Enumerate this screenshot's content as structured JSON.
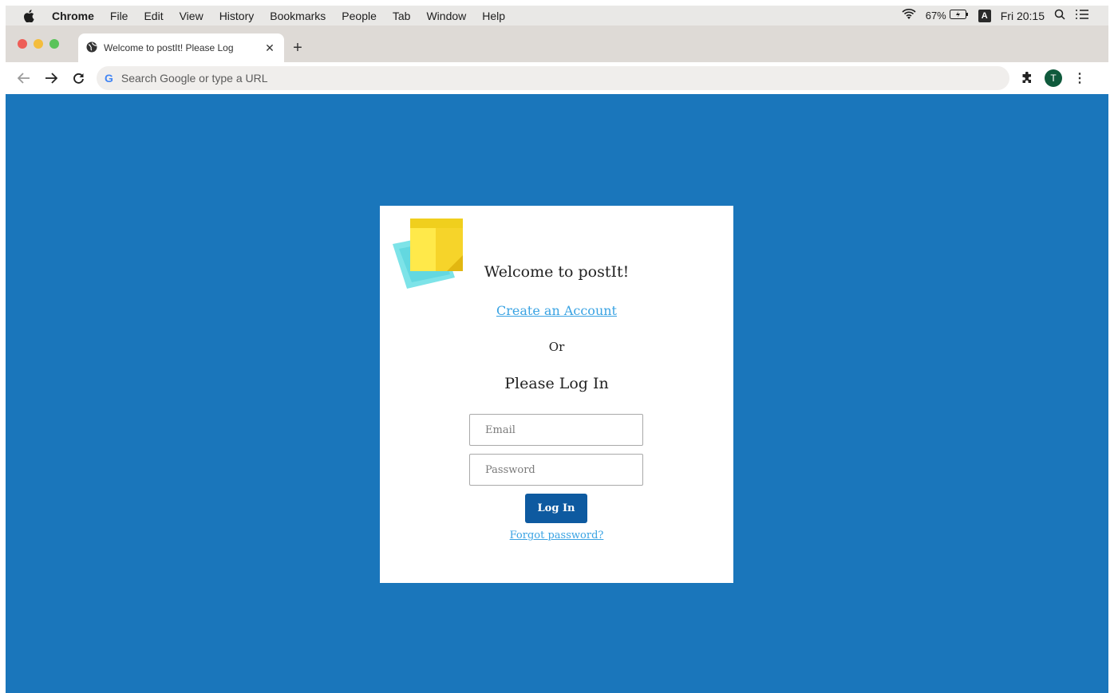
{
  "menubar": {
    "apple_icon": "apple-icon",
    "items": [
      "Chrome",
      "File",
      "Edit",
      "View",
      "History",
      "Bookmarks",
      "People",
      "Tab",
      "Window",
      "Help"
    ],
    "battery": "67%",
    "input_source": "A",
    "clock": "Fri 20:15"
  },
  "tabs": [
    {
      "title": "Welcome to postIt! Please Log"
    }
  ],
  "toolbar": {
    "omnibox_placeholder": "Search Google or type a URL",
    "avatar_initial": "T"
  },
  "login": {
    "welcome": "Welcome to postIt!",
    "create_account": "Create an Account",
    "or": "Or",
    "please_login": "Please Log In",
    "email_placeholder": "Email",
    "password_placeholder": "Password",
    "login_button": "Log In",
    "forgot_password": "Forgot password?"
  },
  "colors": {
    "background": "#1a76bb",
    "link": "#3aa3e3",
    "button": "#0e5aa0"
  }
}
